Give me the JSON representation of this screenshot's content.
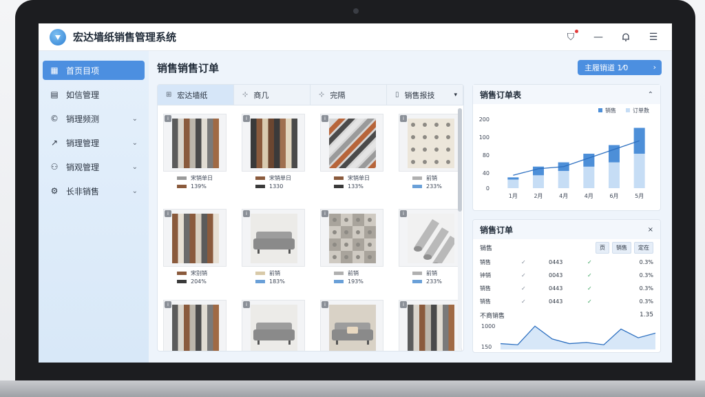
{
  "app": {
    "title": "宏达墙纸销售管理系统"
  },
  "topbar": {
    "icons": [
      "bell-badge-icon",
      "minimize-icon",
      "bell-icon",
      "menu-icon"
    ]
  },
  "sidebar": {
    "items": [
      {
        "label": "首页目项",
        "icon": "dashboard-icon",
        "active": true
      },
      {
        "label": "如信管理",
        "icon": "grid-icon",
        "chevron": false
      },
      {
        "label": "销理频测",
        "icon": "circle-c-icon",
        "chevron": true
      },
      {
        "label": "销理管理",
        "icon": "trend-icon",
        "chevron": true
      },
      {
        "label": "销观管理",
        "icon": "user-icon",
        "chevron": true
      },
      {
        "label": "长非销售",
        "icon": "gear-icon",
        "chevron": true
      }
    ]
  },
  "main": {
    "title": "销售销售订单",
    "action_button": {
      "label": "主履销道  1⁄0",
      "arrow": "›"
    },
    "tabs": [
      {
        "label": "宏达墙纸",
        "active": true
      },
      {
        "label": "商几"
      },
      {
        "label": "完隔"
      },
      {
        "label": "销售报技",
        "chevron": true
      }
    ]
  },
  "products": [
    {
      "name": "宋销单日",
      "price": "139%",
      "swatch1": "#9a9a9a",
      "swatch2": "#8a5a3c",
      "style": "stripes-grey"
    },
    {
      "name": "宋销单日",
      "price": "1330",
      "swatch1": "#8a5a3c",
      "swatch2": "#3a3a3a",
      "style": "stripes-brown"
    },
    {
      "name": "宋销单日",
      "price": "133%",
      "swatch1": "#8a5a3c",
      "swatch2": "#3a3a3a",
      "style": "diagonal"
    },
    {
      "name": "前销",
      "price": "233%",
      "swatch1": "#b0b0b0",
      "swatch2": "#6aa0d8",
      "style": "floral-cream"
    },
    {
      "name": "宋别销",
      "price": "204%",
      "swatch1": "#8a5a3c",
      "swatch2": "#3a3a3a",
      "style": "stripes-ornate"
    },
    {
      "name": "前销",
      "price": "183%",
      "swatch1": "#d8c9a8",
      "swatch2": "#6aa0d8",
      "style": "sofa"
    },
    {
      "name": "前销",
      "price": "193%",
      "swatch1": "#b0b0b0",
      "swatch2": "#6aa0d8",
      "style": "patchwork"
    },
    {
      "name": "前销",
      "price": "233%",
      "swatch1": "#b0b0b0",
      "swatch2": "#6aa0d8",
      "style": "rolls"
    },
    {
      "name": "",
      "price": "",
      "swatch1": "#9a9a9a",
      "swatch2": "#8a5a3c",
      "style": "stripes-grey"
    },
    {
      "name": "",
      "price": "",
      "swatch1": "#d8c9a8",
      "swatch2": "#6aa0d8",
      "style": "sofa"
    },
    {
      "name": "",
      "price": "",
      "swatch1": "#d8c9a8",
      "swatch2": "#6aa0d8",
      "style": "floral-sofa"
    },
    {
      "name": "",
      "price": "",
      "swatch1": "#9a9a9a",
      "swatch2": "#8a5a3c",
      "style": "stripes-grey"
    }
  ],
  "sales_chart": {
    "title": "销售订单表",
    "legend": [
      "销售",
      "订单数"
    ],
    "colors": {
      "bar_dark": "#4d8fd8",
      "bar_light": "#c6ddf5",
      "line": "#2c6fc0"
    },
    "chart_data": {
      "type": "bar",
      "categories": [
        "1月",
        "2月",
        "4月",
        "4月",
        "6月",
        "5月"
      ],
      "series": [
        {
          "name": "销售",
          "values": [
            25,
            50,
            60,
            80,
            100,
            140
          ]
        },
        {
          "name": "订单数",
          "values": [
            20,
            30,
            40,
            50,
            60,
            80
          ]
        }
      ],
      "line": [
        30,
        45,
        50,
        70,
        90,
        110
      ],
      "ylabels": [
        "200",
        "100",
        "80",
        "40",
        "0"
      ],
      "yvalues": [
        200,
        100,
        80,
        40,
        0
      ]
    }
  },
  "orders": {
    "title": "销售订单",
    "close": "×",
    "header_label": "销售",
    "segments": [
      "页",
      "销售",
      "定在"
    ],
    "rows": [
      {
        "name": "销售",
        "a": "✓",
        "b": "0443",
        "c": "✓",
        "d": "0.3%"
      },
      {
        "name": "钟销",
        "a": "✓",
        "b": "0043",
        "c": "✓",
        "d": "0.3%"
      },
      {
        "name": "销售",
        "a": "✓",
        "b": "0443",
        "c": "✓",
        "d": "0.3%"
      },
      {
        "name": "销售",
        "a": "✓",
        "b": "0443",
        "c": "✓",
        "d": "0.3%"
      }
    ],
    "summary": {
      "label": "不商销售",
      "value": "1.35"
    },
    "mini_chart": {
      "ylabels": [
        "1000",
        "150"
      ],
      "values": [
        10,
        8,
        40,
        18,
        10,
        12,
        8,
        35,
        20,
        28
      ]
    }
  }
}
